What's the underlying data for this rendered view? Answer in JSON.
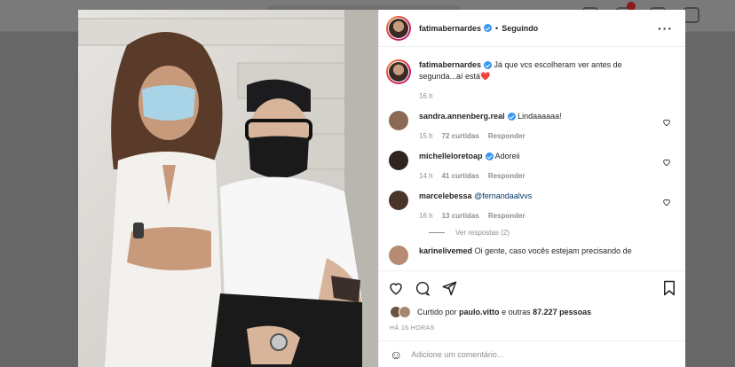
{
  "post": {
    "author": "fatimabernardes",
    "follow_label": "Seguindo",
    "caption_user": "fatimabernardes",
    "caption_text": "Já que vcs escolheram ver antes de segunda...aí está",
    "caption_emoji": "❤️",
    "caption_age": "16 h"
  },
  "comments": [
    {
      "user": "sandra.annenberg.real",
      "verified": true,
      "text": "Lindaaaaaa!",
      "age": "15 h",
      "likes": "72 curtidas",
      "reply": "Responder",
      "avatar_color": "#8a6a55"
    },
    {
      "user": "michelleloretoap",
      "verified": true,
      "text": "Adoreii",
      "age": "14 h",
      "likes": "41 curtidas",
      "reply": "Responder",
      "avatar_color": "#2f2420"
    },
    {
      "user": "marcelebessa",
      "verified": false,
      "mention": "@fernandaalvvs",
      "text": "",
      "age": "16 h",
      "likes": "13 curtidas",
      "reply": "Responder",
      "avatar_color": "#4a3428",
      "view_replies": "Ver respostas (2)"
    },
    {
      "user": "karinelivemed",
      "verified": false,
      "text": "Oi gente, caso vocês estejam precisando de",
      "avatar_color": "#b58b73"
    }
  ],
  "liked_by": {
    "prefix": "Curtido por",
    "user": "paulo.vitto",
    "suffix": "e outras",
    "count": "87.227 pessoas"
  },
  "date": "HÁ 16 HORAS",
  "add_comment_placeholder": "Adicione um comentário...",
  "icons": [
    "heart-icon",
    "comment-icon",
    "share-icon",
    "bookmark-icon",
    "more-icon",
    "emoji-icon"
  ]
}
